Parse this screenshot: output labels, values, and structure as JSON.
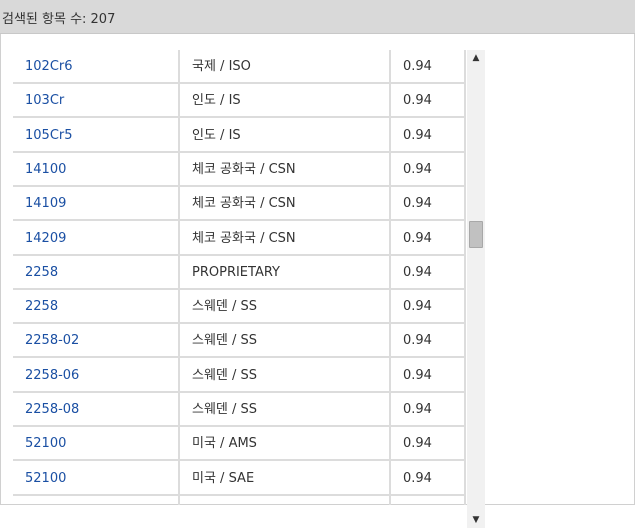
{
  "header": {
    "result_count_label": "검색된 항목 수: 207"
  },
  "table": {
    "rows": [
      {
        "designation": "102Cr6",
        "standard": "국제 / ISO",
        "similarity": "0.94"
      },
      {
        "designation": "103Cr",
        "standard": "인도 / IS",
        "similarity": "0.94"
      },
      {
        "designation": "105Cr5",
        "standard": "인도 / IS",
        "similarity": "0.94"
      },
      {
        "designation": "14100",
        "standard": "체코 공화국 / CSN",
        "similarity": "0.94"
      },
      {
        "designation": "14109",
        "standard": "체코 공화국 / CSN",
        "similarity": "0.94"
      },
      {
        "designation": "14209",
        "standard": "체코 공화국 / CSN",
        "similarity": "0.94"
      },
      {
        "designation": "2258",
        "standard": "PROPRIETARY",
        "similarity": "0.94"
      },
      {
        "designation": "2258",
        "standard": "스웨덴 / SS",
        "similarity": "0.94"
      },
      {
        "designation": "2258-02",
        "standard": "스웨덴 / SS",
        "similarity": "0.94"
      },
      {
        "designation": "2258-06",
        "standard": "스웨덴 / SS",
        "similarity": "0.94"
      },
      {
        "designation": "2258-08",
        "standard": "스웨덴 / SS",
        "similarity": "0.94"
      },
      {
        "designation": "52100",
        "standard": "미국 / AMS",
        "similarity": "0.94"
      },
      {
        "designation": "52100",
        "standard": "미국 / SAE",
        "similarity": "0.94"
      }
    ]
  },
  "scrollbar": {
    "up_glyph": "▲",
    "down_glyph": "▼",
    "scroll_fraction": 0.37
  }
}
